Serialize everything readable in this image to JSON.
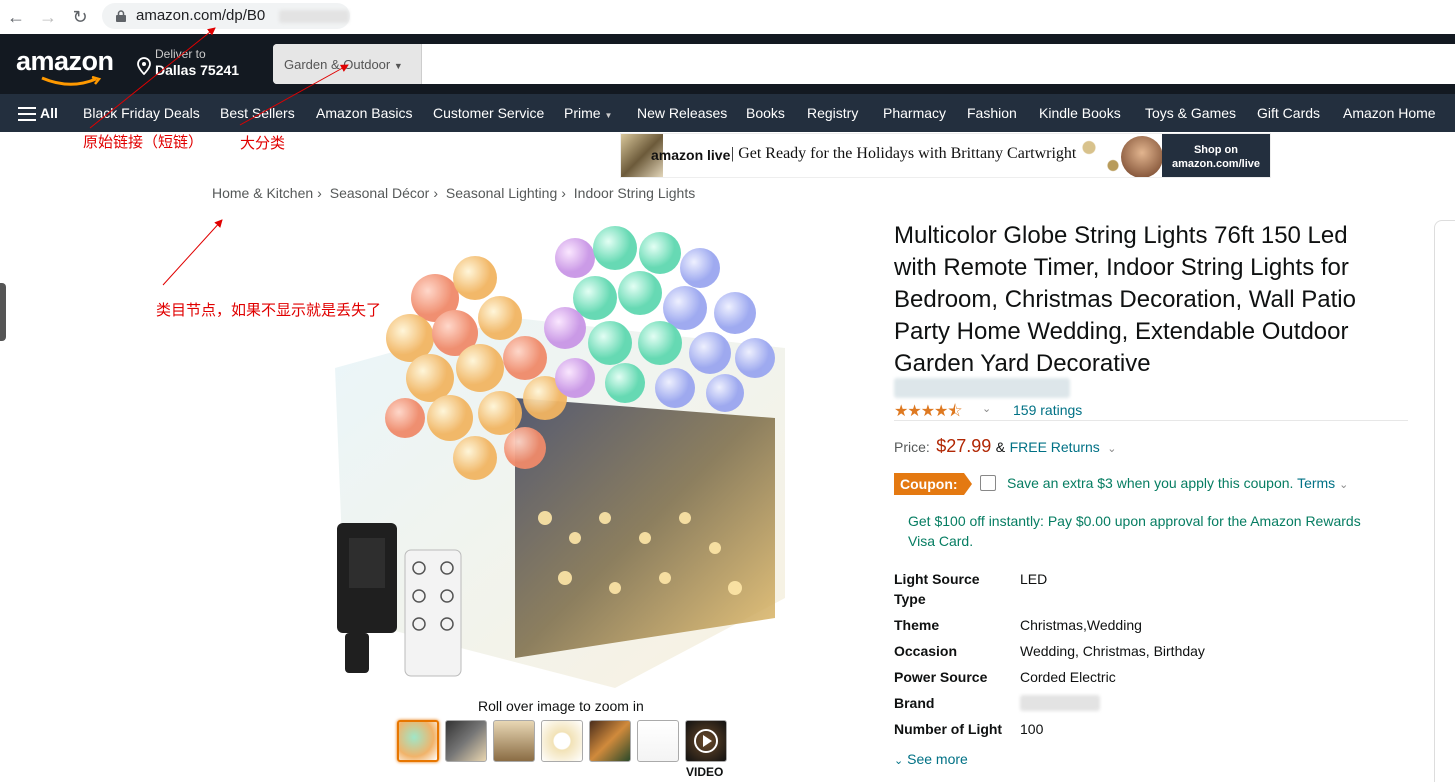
{
  "browser": {
    "url_visible": "amazon.com/dp/B0"
  },
  "header": {
    "logo_text": "amazon",
    "deliver_line1": "Deliver to",
    "deliver_line2": "Dallas 75241",
    "search_category": "Garden & Outdoor",
    "search_placeholder": ""
  },
  "subnav": {
    "all_label": "All",
    "items": [
      "Black Friday Deals",
      "Best Sellers",
      "Amazon Basics",
      "Customer Service",
      "Prime",
      "New Releases",
      "Books",
      "Registry",
      "Pharmacy",
      "Fashion",
      "Kindle Books",
      "Toys & Games",
      "Gift Cards",
      "Amazon Home"
    ]
  },
  "annotations": {
    "short_link": "原始链接（短链）",
    "category": "大分类",
    "node": "类目节点，如果不显示就是丢失了"
  },
  "banner": {
    "brand": "amazon live",
    "tagline": "| Get Ready for the Holidays with Brittany Cartwright",
    "cta_line1": "Shop on",
    "cta_line2": "amazon.com/live"
  },
  "breadcrumbs": [
    "Home & Kitchen",
    "Seasonal Décor",
    "Seasonal Lighting",
    "Indoor String Lights"
  ],
  "breadcrumb_separator": "›",
  "gallery": {
    "rollover_text": "Roll over image to zoom in",
    "video_label": "VIDEO"
  },
  "product": {
    "title": "Multicolor Globe String Lights 76ft 150 Led with Remote Timer, Indoor String Lights for Bedroom, Christmas Decoration, Wall Patio Party Home Wedding, Extendable Outdoor Garden Yard Decorative",
    "stars": "★★★★⯪",
    "rating_value": 4.5,
    "ratings_count": "159 ratings",
    "price_label": "Price:",
    "price": "$27.99",
    "price_and": "&",
    "free_returns": "FREE Returns",
    "coupon_badge": "Coupon:",
    "coupon_text": "Save an extra $3 when you apply this coupon.",
    "coupon_terms": "Terms",
    "promo": "Get $100 off instantly: Pay $0.00 upon approval for the Amazon Rewards Visa Card.",
    "specs": [
      {
        "k": "Light Source Type",
        "v": "LED"
      },
      {
        "k": "Theme",
        "v": "Christmas,Wedding"
      },
      {
        "k": "Occasion",
        "v": "Wedding, Christmas, Birthday"
      },
      {
        "k": "Power Source",
        "v": "Corded Electric"
      },
      {
        "k": "Brand",
        "v": ""
      },
      {
        "k": "Number of Light Sources",
        "v": "100"
      }
    ],
    "see_more": "See more"
  },
  "colors": {
    "nav_dark": "#131921",
    "subnav": "#232f3e",
    "price": "#B12704",
    "link": "#007185",
    "coupon": "#e47911",
    "annotation": "#e00000"
  }
}
